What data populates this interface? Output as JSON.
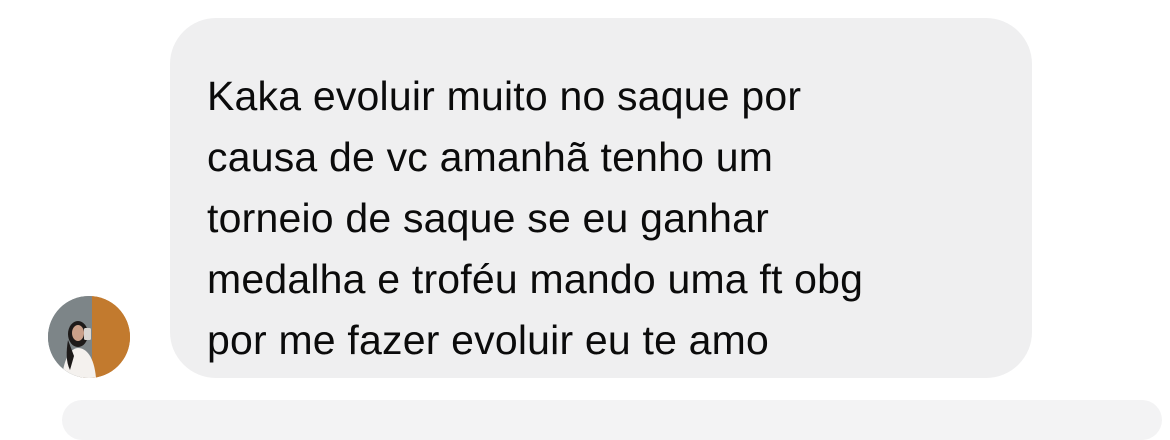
{
  "thread": {
    "messages": [
      {
        "direction": "incoming",
        "avatar_icon": "user-avatar-photo",
        "text": "Kaka evoluir muito no saque por\ncausa de vc amanhã tenho um\ntorneio de saque se eu ganhar\nmedalha e troféu mando uma ft obg\npor me fazer evoluir eu te amo"
      }
    ]
  },
  "colors": {
    "background": "#ffffff",
    "bubble_incoming": "#efeff0",
    "text": "#0b0b0b"
  }
}
